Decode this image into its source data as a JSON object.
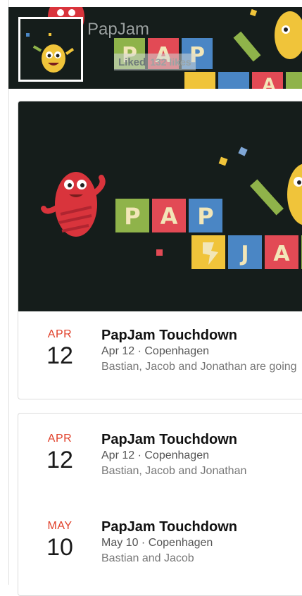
{
  "header": {
    "page_name": "PapJam",
    "liked_label": "Liked",
    "likes_count": "132 likes"
  },
  "colors": {
    "dark_bg": "#151d1b",
    "tile_green": "#8fb34a",
    "tile_blue": "#4a86c5",
    "tile_red": "#e24a55",
    "tile_yellow": "#f0c43a",
    "month_red": "#e0402a"
  },
  "banner_letters": [
    "P",
    "A",
    "P",
    "J",
    "A"
  ],
  "events": [
    {
      "month": "APR",
      "day": "12",
      "title": "PapJam Touchdown",
      "meta": "Apr 12 · Copenhagen",
      "people": "Bastian, Jacob and Jonathan are going"
    },
    {
      "month": "APR",
      "day": "12",
      "title": "PapJam Touchdown",
      "meta": "Apr 12 · Copenhagen",
      "people": "Bastian, Jacob and Jonathan"
    },
    {
      "month": "MAY",
      "day": "10",
      "title": "PapJam Touchdown",
      "meta": "May 10 · Copenhagen",
      "people": "Bastian and Jacob"
    }
  ]
}
